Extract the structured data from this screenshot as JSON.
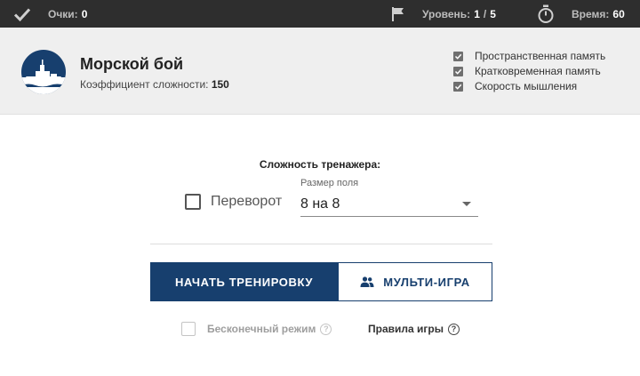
{
  "topbar": {
    "score_label": "Очки:",
    "score_value": "0",
    "level_label": "Уровень:",
    "level_current": "1",
    "level_separator": "/",
    "level_total": "5",
    "time_label": "Время:",
    "time_value": "60",
    "icons": [
      "check-icon",
      "flag-icon",
      "stopwatch-icon"
    ]
  },
  "game": {
    "title": "Морской бой",
    "difficulty_label": "Коэффициент сложности:",
    "difficulty_value": "150",
    "logo_icon": "battleship-logo-icon"
  },
  "skills": [
    {
      "label": "Пространственная память",
      "checked": true
    },
    {
      "label": "Кратковременная память",
      "checked": true
    },
    {
      "label": "Скорость мышления",
      "checked": true
    }
  ],
  "settings": {
    "title": "Сложность тренажера:",
    "flip_label": "Переворот",
    "flip_checked": false,
    "field_size_label": "Размер поля",
    "field_size_value": "8 на 8"
  },
  "actions": {
    "start_label": "НАЧАТЬ ТРЕНИРОВКУ",
    "multi_label": "МУЛЬТИ-ИГРА",
    "endless_label": "Бесконечный режим",
    "endless_checked": false,
    "rules_label": "Правила игры",
    "help_glyph": "?"
  },
  "colors": {
    "primary": "#173f6e",
    "topbar_bg": "#2e2e2e",
    "header_bg": "#efefef"
  }
}
